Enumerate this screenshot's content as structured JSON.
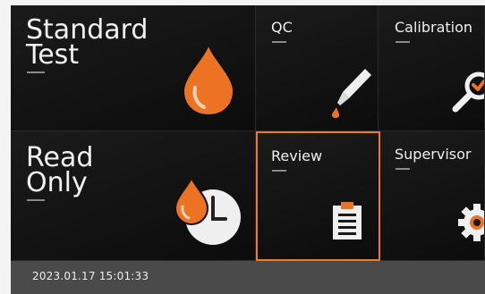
{
  "tiles": {
    "standard_test": {
      "label": "Standard\nTest",
      "icon": "blood-drop-icon"
    },
    "qc": {
      "label": "QC",
      "icon": "pipette-icon"
    },
    "calibration": {
      "label": "Calibration",
      "icon": "magnifier-check-icon"
    },
    "read_only": {
      "label": "Read\nOnly",
      "icon": "drop-clock-icon"
    },
    "review": {
      "label": "Review",
      "icon": "clipboard-icon",
      "selected": true
    },
    "supervisor": {
      "label": "Supervisor",
      "icon": "gear-icon"
    }
  },
  "status_bar": {
    "datetime": "2023.01.17  15:01:33"
  },
  "colors": {
    "accent": "#ea7a2d",
    "background": "#0d0d0d",
    "status_bar": "#4a4a4a"
  }
}
